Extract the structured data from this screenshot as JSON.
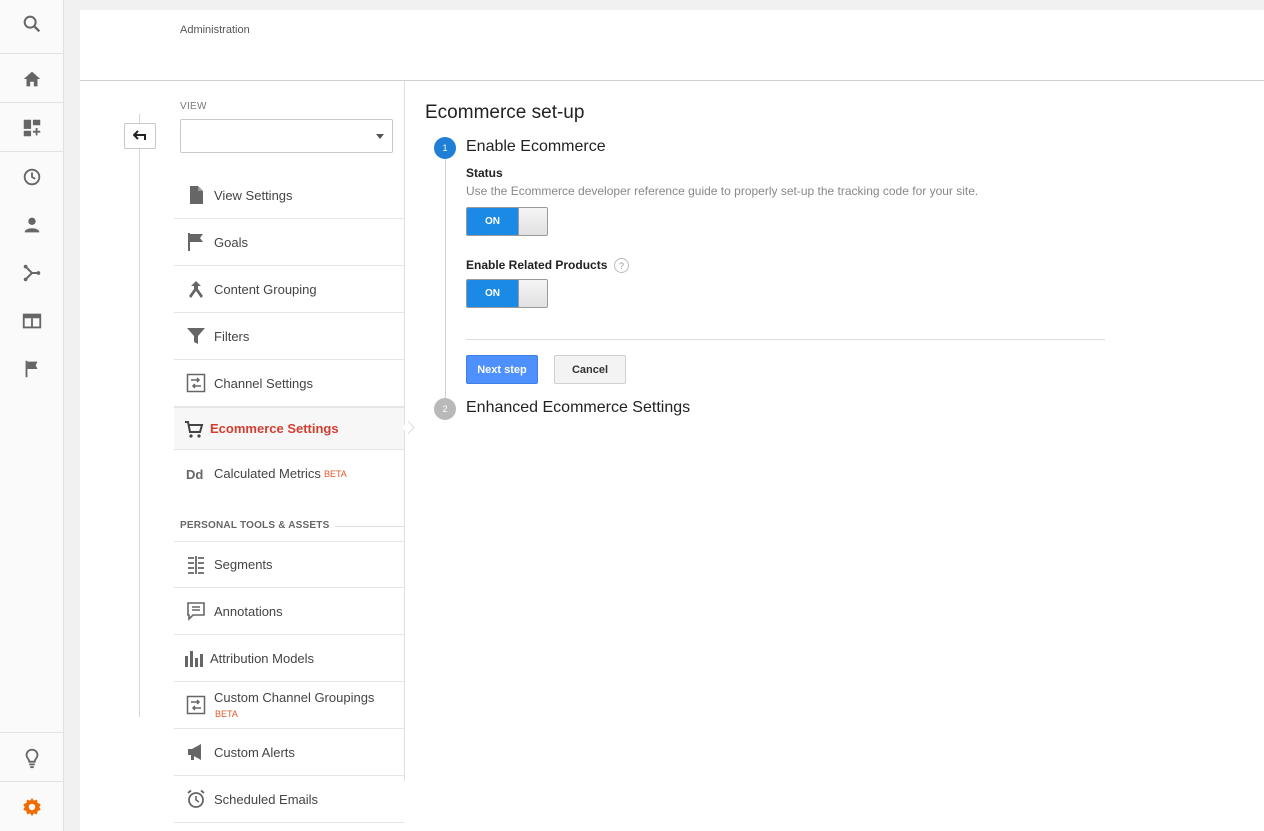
{
  "colors": {
    "accent": "#1a8ae6",
    "active_text": "#d23f31",
    "beta": "#e0582c",
    "gear_active": "#ef6c00"
  },
  "rail": {
    "icons": [
      "search-icon",
      "home-icon",
      "customization-icon",
      "realtime-icon",
      "audience-icon",
      "acquisition-icon",
      "behavior-icon",
      "conversions-icon",
      "discover-icon",
      "admin-gear-icon"
    ]
  },
  "header": {
    "title": "Administration"
  },
  "view": {
    "label": "VIEW",
    "selected": ""
  },
  "menu": {
    "view_settings": "View Settings",
    "goals": "Goals",
    "content_grouping": "Content Grouping",
    "filters": "Filters",
    "channel_settings": "Channel Settings",
    "ecommerce_settings": "Ecommerce Settings",
    "calculated_metrics": "Calculated Metrics",
    "calculated_metrics_badge": "BETA"
  },
  "personal": {
    "heading": "PERSONAL TOOLS & ASSETS",
    "segments": "Segments",
    "annotations": "Annotations",
    "attribution_models": "Attribution Models",
    "custom_channel_groupings": "Custom Channel Groupings",
    "custom_channel_groupings_badge": "BETA",
    "custom_alerts": "Custom Alerts",
    "scheduled_emails": "Scheduled Emails"
  },
  "content": {
    "title": "Ecommerce set-up",
    "step1": {
      "number": "1",
      "title": "Enable Ecommerce",
      "status_label": "Status",
      "status_help": "Use the Ecommerce developer reference guide to properly set-up the tracking code for your site.",
      "status_toggle": "ON",
      "related_label": "Enable Related Products",
      "related_help_icon": "?",
      "related_toggle": "ON",
      "next_button": "Next step",
      "cancel_button": "Cancel"
    },
    "step2": {
      "number": "2",
      "title": "Enhanced Ecommerce Settings"
    }
  }
}
